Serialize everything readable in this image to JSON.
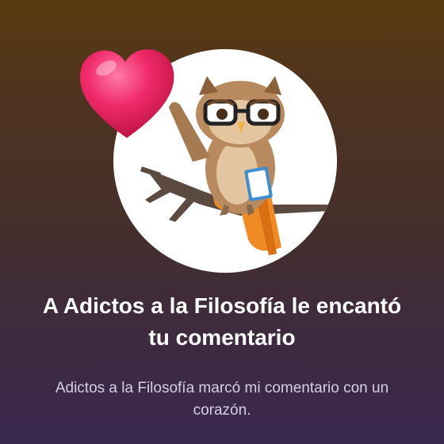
{
  "notification": {
    "title": "A Adictos a la Filosofía le encantó tu comentario",
    "subtitle": "Adictos a la Filosofía marcó mi comentario con un corazón."
  },
  "avatar": {
    "icon": "owl-mascot-icon"
  },
  "reaction": {
    "icon": "heart-icon",
    "color": "#e8185a"
  },
  "colors": {
    "background_top": "#5a3a0f",
    "background_bottom": "#3a2750",
    "title_text": "#ffffff",
    "subtitle_text": "#d8cfe3"
  }
}
